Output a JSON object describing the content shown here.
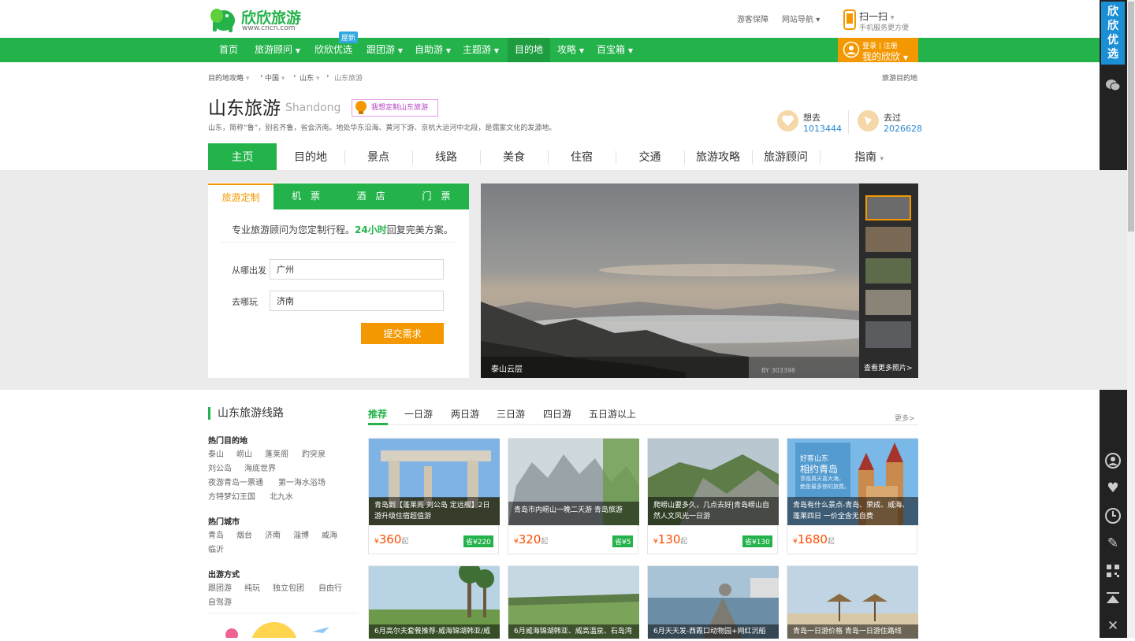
{
  "header": {
    "logo_text": "欣欣旅游",
    "logo_url": "www.cncn.com",
    "links": [
      "游客保障",
      "网站导航"
    ],
    "scan_title": "扫一扫",
    "scan_sub": "手机服务更方便",
    "login_top": "登录 | 注册",
    "login_bottom": "我的欣欣"
  },
  "nav": {
    "items": [
      "首页",
      "旅游顾问",
      "欣欣优选",
      "跟团游",
      "自助游",
      "主题游",
      "目的地",
      "攻略",
      "百宝箱"
    ],
    "badge": "屋新",
    "active": "目的地"
  },
  "sidebar": {
    "top_label": "欣欣优选",
    "icons": [
      "wechat-icon",
      "user-icon",
      "heart-icon",
      "clock-icon",
      "edit-icon",
      "qrcode-icon",
      "back-to-top-icon",
      "close-icon"
    ]
  },
  "breadcrumb": {
    "items": [
      "目的地攻略",
      "中国",
      "山东",
      "山东旅游"
    ],
    "right": "旅游目的地"
  },
  "destination": {
    "title": "山东旅游",
    "subtitle": "Shandong",
    "custom_button": "我想定制山东旅游",
    "description": "山东，简称“鲁”，别名齐鲁，省会济南。地处华东沿海、黄河下游、京杭大运河中北段，是儒家文化的发源地。",
    "want_label": "想去",
    "want_count": "1013444",
    "been_label": "去过",
    "been_count": "2026628"
  },
  "tabs": [
    "主页",
    "目的地",
    "景点",
    "线路",
    "美食",
    "住宿",
    "交通",
    "旅游攻略",
    "旅游顾问",
    "指南"
  ],
  "form": {
    "tabs": [
      "旅游定制",
      "机　票",
      "酒　店",
      "门　票"
    ],
    "tip_pre": "专业旅游顾问为您定制行程。",
    "tip_bold": "24小时",
    "tip_post": "回复完美方案。",
    "from_label": "从哪出发",
    "from_value": "广州",
    "to_label": "去哪玩",
    "to_value": "济南",
    "submit": "提交需求"
  },
  "photo": {
    "caption": "泰山云层",
    "more": "查看更多照片>",
    "watermark": "BY 303398"
  },
  "routes": {
    "title": "山东旅游线路",
    "tabs": [
      "推荐",
      "一日游",
      "两日游",
      "三日游",
      "四日游",
      "五日游以上"
    ],
    "more": "更多>",
    "hot_dest_head": "热门目的地",
    "hot_dest": [
      [
        "泰山",
        "崂山",
        "蓬莱阁",
        "趵突泉"
      ],
      [
        "刘公岛",
        "海底世界"
      ],
      [
        "夜游青岛一票通",
        "第一海水浴场"
      ],
      [
        "方特梦幻王国",
        "北九水"
      ]
    ],
    "hot_city_head": "热门城市",
    "hot_city": [
      [
        "青岛",
        "烟台",
        "济南",
        "淄博",
        "威海"
      ],
      [
        "临沂"
      ]
    ],
    "mode_head": "出游方式",
    "mode": [
      [
        "跟团游",
        "纯玩",
        "独立包团",
        "自由行"
      ],
      [
        "自驾游"
      ]
    ],
    "cards": [
      {
        "text": "青岛到【蓬莱阁 刘公岛 定远舰】2日游升级住宿超值游",
        "price": "360",
        "unit": "起",
        "save": "省¥220"
      },
      {
        "text": "青岛市内崂山一晚二天游 青岛旅游",
        "price": "320",
        "unit": "起",
        "save": "省¥5"
      },
      {
        "text": "爬崂山要多久，几点去好|青岛崂山自然人文风光一日游",
        "price": "130",
        "unit": "起",
        "save": "省¥130"
      },
      {
        "text": "青岛有什么景点-青岛、荣成、威海、蓬莱四日 一价全含无自费",
        "price": "1680",
        "unit": "起",
        "save": ""
      }
    ],
    "card4_overlay": [
      "好客山东",
      "相约青岛",
      "享临真天喜大海，",
      "绝是最多惊的旅费。"
    ],
    "cards2": [
      "6月高尔夫套餐推荐-威海锦湖韩亚/威",
      "6月威海锦湖韩亚、威高温泉、石岛湾",
      "6月天天发-西霞口动物园+网红沉船",
      "青岛一日游价格 青岛一日游住路线"
    ]
  },
  "colors": {
    "brand_green": "#24b34b",
    "orange": "#f39800",
    "price_red": "#ff4d00",
    "link_blue": "#2a88d0"
  }
}
